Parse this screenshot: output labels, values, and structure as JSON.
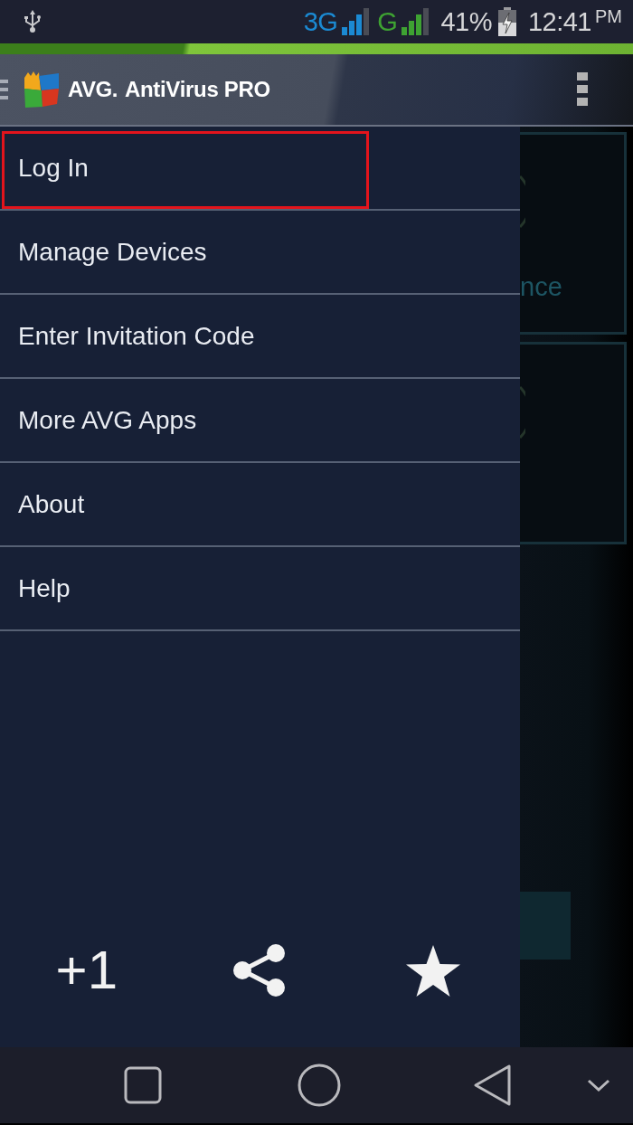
{
  "status_bar": {
    "networks": [
      {
        "label": "3G",
        "color": "#1b8ad3"
      },
      {
        "label": "G",
        "color": "#3ea232"
      }
    ],
    "battery": "41%",
    "time": "12:41",
    "time_suffix": "PM"
  },
  "app_bar": {
    "brand": "AVG.",
    "title": "AntiVirus PRO"
  },
  "drawer": {
    "items": [
      {
        "label": "Log In",
        "highlighted": true
      },
      {
        "label": "Manage Devices",
        "highlighted": false
      },
      {
        "label": "Enter Invitation Code",
        "highlighted": false
      },
      {
        "label": "More AVG Apps",
        "highlighted": false
      },
      {
        "label": "About",
        "highlighted": false
      },
      {
        "label": "Help",
        "highlighted": false
      }
    ],
    "plus_one": "+1"
  },
  "background": {
    "card_text": "nce"
  }
}
